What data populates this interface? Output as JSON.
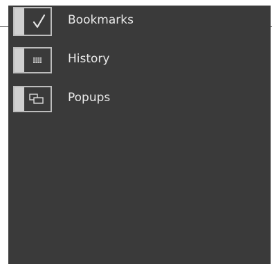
{
  "menu": {
    "items": [
      {
        "label": "Bookmarks",
        "icon": "checkmark-icon",
        "checked": true
      },
      {
        "label": "History",
        "icon": "history-grid-icon",
        "checked": false
      },
      {
        "label": "Popups",
        "icon": "popups-windows-icon",
        "checked": false
      }
    ]
  },
  "colors": {
    "panel_bg": "#3a3a3a",
    "border": "#bdbdbd",
    "text": "#eaeaea"
  }
}
